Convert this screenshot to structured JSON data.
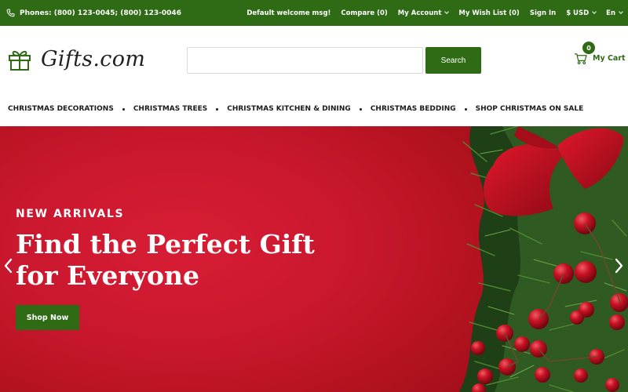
{
  "topbar": {
    "phones": "Phones: (800) 123-0045; (800) 123-0046",
    "phone_icon": "phone-icon",
    "welcome": "Default welcome msg!",
    "compare": "Compare (0)",
    "account": "My Account",
    "wishlist": "My Wish List (0)",
    "signin": "Sign In",
    "currency": "$ USD",
    "language": "En"
  },
  "header": {
    "logo_text": "Gifts.com",
    "logo_icon": "gift-box-icon",
    "search": {
      "placeholder": "",
      "value": "",
      "button_label": "Search"
    },
    "cart": {
      "count": "0",
      "label": "My Cart",
      "icon": "cart-icon"
    }
  },
  "nav": {
    "items": [
      "CHRISTMAS DECORATIONS",
      "CHRISTMAS TREES",
      "CHRISTMAS KITCHEN & DINING",
      "CHRISTMAS BEDDING",
      "SHOP CHRISTMAS ON SALE"
    ]
  },
  "hero": {
    "eyebrow": "NEW ARRIVALS",
    "headline_line1": "Find the Perfect Gift",
    "headline_line2": "for Everyone",
    "cta_label": "Shop Now",
    "prev_icon": "chevron-left-icon",
    "next_icon": "chevron-right-icon"
  },
  "colors": {
    "brand_green": "#2f6a14",
    "hero_red": "#c8172d",
    "berry_red": "#c81224",
    "pine_green": "#2f5a22"
  }
}
